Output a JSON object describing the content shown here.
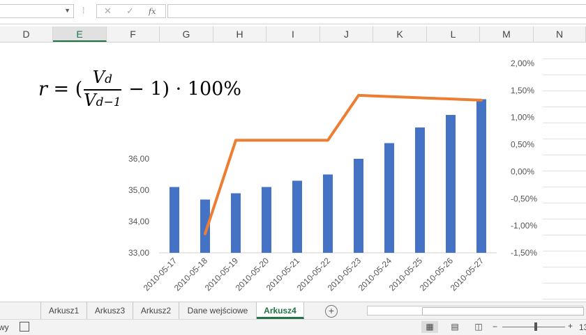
{
  "columns": [
    "D",
    "E",
    "F",
    "G",
    "H",
    "I",
    "J",
    "K",
    "L",
    "M",
    "N"
  ],
  "selected_column": "E",
  "formula_bar": {
    "fx_label": "fx",
    "cancel_icon": "✕",
    "enter_icon": "✓",
    "dots": "⁞"
  },
  "formula_text": {
    "r": "r",
    "eq": " = (",
    "num": "V",
    "num_sub": "d",
    "den": "V",
    "den_sub": "d−1",
    "tail": " − 1) · 100%"
  },
  "chart_data": {
    "type": "bar+line",
    "categories": [
      "2010-05-17",
      "2010-05-18",
      "2010-05-19",
      "2010-05-20",
      "2010-05-21",
      "2010-05-22",
      "2010-05-23",
      "2010-05-24",
      "2010-05-25",
      "2010-05-26",
      "2010-05-27"
    ],
    "series": [
      {
        "type": "bar",
        "axis": "left",
        "color": "#4472c4",
        "values": [
          35.1,
          34.7,
          34.9,
          35.1,
          35.3,
          35.5,
          36.0,
          36.5,
          37.0,
          37.4,
          37.9
        ]
      },
      {
        "type": "line",
        "axis": "right",
        "color": "#ed7d31",
        "values": [
          null,
          -1.15,
          0.58,
          null,
          null,
          0.58,
          1.41,
          null,
          null,
          null,
          1.32
        ]
      }
    ],
    "y_left": {
      "min": 33,
      "max": 36,
      "ticks": [
        "33,00",
        "34,00",
        "35,00",
        "36,00"
      ]
    },
    "y_right": {
      "min": -1.5,
      "max": 2.0,
      "ticks": [
        "-1,50%",
        "-1,00%",
        "-0,50%",
        "0,00%",
        "0,50%",
        "1,00%",
        "1,50%",
        "2,00%"
      ]
    },
    "grid": false
  },
  "sheet_tabs": [
    "Arkusz1",
    "Arkusz3",
    "Arkusz2",
    "Dane wejściowe",
    "Arkusz4"
  ],
  "active_tab": "Arkusz4",
  "status": {
    "left_text": "wy",
    "zoom": "13"
  },
  "icons": [
    "namebox-dropdown-icon",
    "cancel-icon",
    "enter-icon",
    "fx-icon",
    "add-sheet-icon",
    "normal-view-icon",
    "page-layout-icon",
    "page-break-icon"
  ]
}
